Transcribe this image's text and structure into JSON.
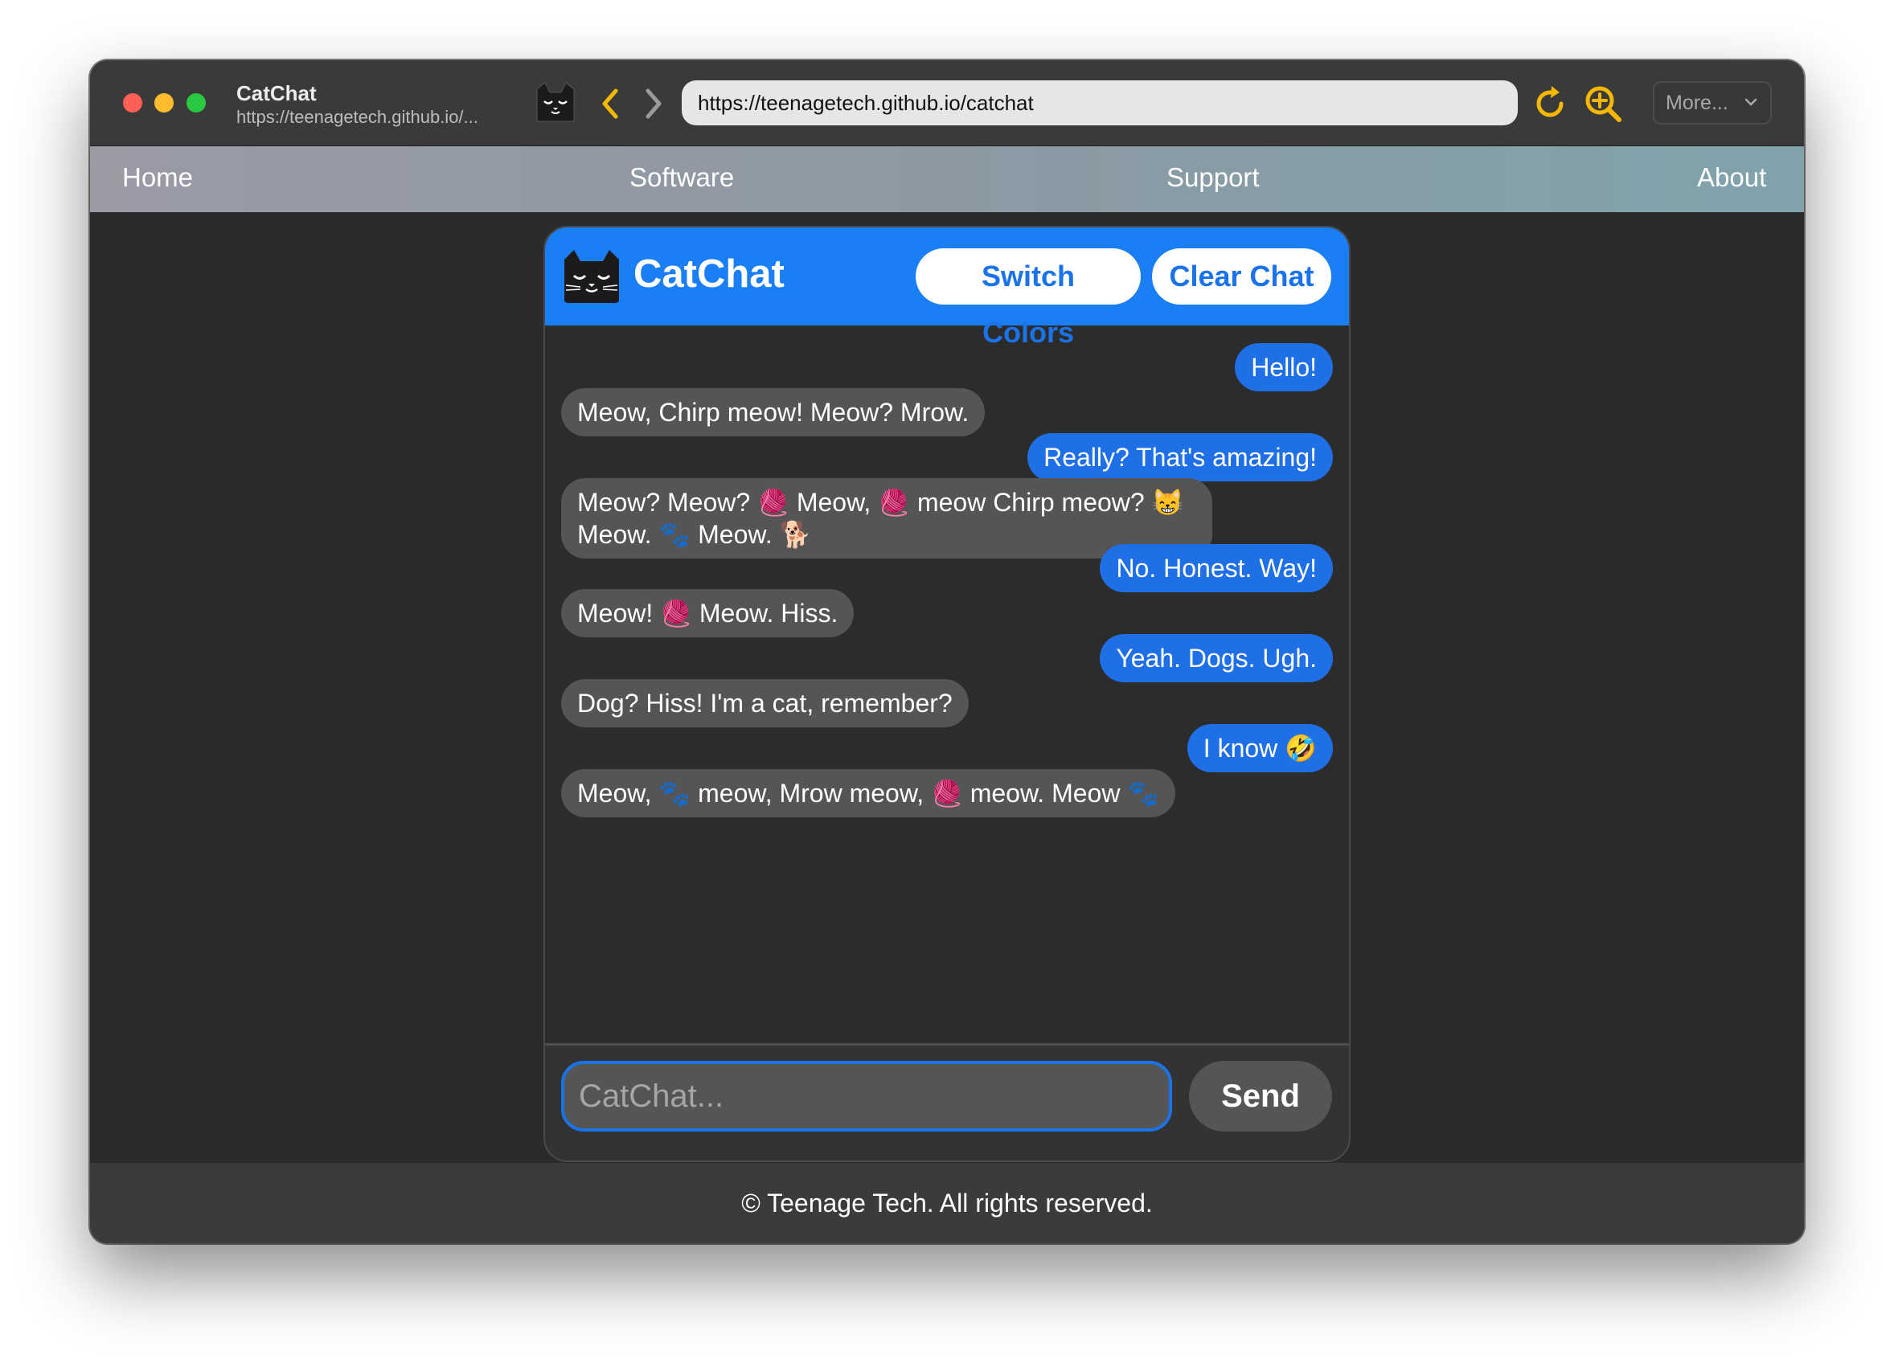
{
  "window": {
    "title": "CatChat",
    "subtitle_url": "https://teenagetech.github.io/...",
    "address": "https://teenagetech.github.io/catchat",
    "more_label": "More..."
  },
  "nav": {
    "home": "Home",
    "software": "Software",
    "support": "Support",
    "about": "About"
  },
  "chat": {
    "title": "CatChat",
    "switch_colors": "Switch Colors",
    "clear_chat": "Clear Chat",
    "messages": [
      {
        "from": "user",
        "text": "Hello!"
      },
      {
        "from": "cat",
        "text": "Meow, Chirp meow! Meow? Mrow."
      },
      {
        "from": "user",
        "text": "Really? That's amazing!"
      },
      {
        "from": "cat",
        "text": "Meow? Meow? 🧶 Meow, 🧶 meow Chirp meow? 😸 Meow. 🐾 Meow. 🐕"
      },
      {
        "from": "user",
        "text": "No. Honest. Way!"
      },
      {
        "from": "cat",
        "text": "Meow! 🧶 Meow. Hiss."
      },
      {
        "from": "user",
        "text": "Yeah. Dogs. Ugh."
      },
      {
        "from": "cat",
        "text": "Dog? Hiss! I'm a cat, remember?"
      },
      {
        "from": "user",
        "text": "I know 🤣"
      },
      {
        "from": "cat",
        "text": "Meow, 🐾 meow, Mrow meow, 🧶 meow. Meow 🐾"
      }
    ],
    "input_placeholder": "CatChat...",
    "send_label": "Send"
  },
  "footer": {
    "text": "© Teenage Tech. All rights reserved."
  },
  "colors": {
    "accent": "#1a7ef5",
    "user_bubble": "#1f6fe6",
    "cat_bubble": "#555555",
    "toolbar_icon": "#f5b800"
  }
}
